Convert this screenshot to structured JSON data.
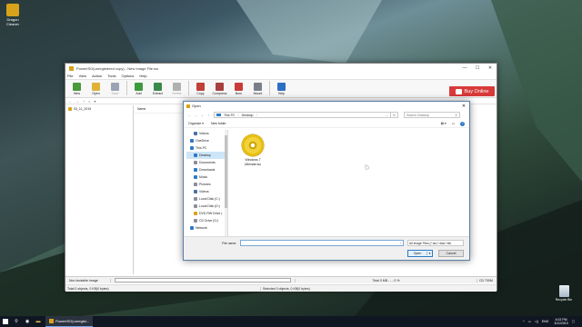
{
  "desktop": {
    "icon_label": "Dragon Cleaner",
    "recycle_label": "Recycle Bin"
  },
  "app": {
    "title": "PowerISO(unregistered copy) - New Image File.iso",
    "window_buttons": {
      "minimize": "—",
      "maximize": "☐",
      "close": "✕"
    },
    "menu": [
      "File",
      "View",
      "Action",
      "Tools",
      "Options",
      "Help"
    ],
    "toolbar": [
      {
        "label": "New",
        "icon": "new-icon",
        "color": "#4a9a3c",
        "disabled": false
      },
      {
        "label": "Open",
        "icon": "open-icon",
        "color": "#e0b23a",
        "disabled": false
      },
      {
        "label": "Save",
        "icon": "save-icon",
        "color": "#9aa4b2",
        "disabled": true
      },
      {
        "label": "Add",
        "icon": "add-icon",
        "color": "#3e9a3e",
        "disabled": false
      },
      {
        "label": "Extract",
        "icon": "extract-icon",
        "color": "#3a8a4a",
        "disabled": false
      },
      {
        "label": "Delete",
        "icon": "delete-icon",
        "color": "#b0b0b0",
        "disabled": true
      },
      {
        "label": "Copy",
        "icon": "copy-icon",
        "color": "#c0403a",
        "disabled": false
      },
      {
        "label": "Compress",
        "icon": "compress-icon",
        "color": "#a84040",
        "disabled": false
      },
      {
        "label": "Burn",
        "icon": "burn-icon",
        "color": "#c93a3a",
        "disabled": false
      },
      {
        "label": "Mount",
        "icon": "mount-icon",
        "color": "#7a7f88",
        "disabled": false
      },
      {
        "label": "Help",
        "icon": "help-icon",
        "color": "#2d6fc4",
        "disabled": false
      }
    ],
    "buy_label": "Buy Online",
    "nav_glyphs": [
      "←",
      "→",
      "↑",
      "⌂",
      "▾"
    ],
    "tree_root": "03_11_2019",
    "column_name": "Name",
    "status_type": "Non-bootable Image",
    "status_total": "Total 0 MB  - - -  0 %",
    "status_media": "CD 700M",
    "status_objects_left": "Total 0 objects, 0 KB(0 bytes)",
    "status_objects_right": "Selected 0 objects, 0 KB(0 bytes)"
  },
  "dialog": {
    "title": "Open",
    "close": "✕",
    "address": {
      "root": "This PC",
      "current": "Desktop"
    },
    "search_placeholder": "Search Desktop",
    "organize": "Organize ▾",
    "new_folder": "New folder",
    "nav_items": [
      {
        "label": "Videos",
        "icon": "videos-icon",
        "color": "#4a6fa5",
        "top": false,
        "selected": false
      },
      {
        "label": "OneDrive",
        "icon": "onedrive-icon",
        "color": "#2d7ac6",
        "top": true,
        "selected": false
      },
      {
        "label": "This PC",
        "icon": "this-pc-icon",
        "color": "#2d7ac6",
        "top": true,
        "selected": false
      },
      {
        "label": "Desktop",
        "icon": "desktop-icon",
        "color": "#2d7ac6",
        "top": false,
        "selected": true
      },
      {
        "label": "Documents",
        "icon": "documents-icon",
        "color": "#8a8f98",
        "top": false,
        "selected": false
      },
      {
        "label": "Downloads",
        "icon": "downloads-icon",
        "color": "#2d7ac6",
        "top": false,
        "selected": false
      },
      {
        "label": "Music",
        "icon": "music-icon",
        "color": "#2d7ac6",
        "top": false,
        "selected": false
      },
      {
        "label": "Pictures",
        "icon": "pictures-icon",
        "color": "#8a8f98",
        "top": false,
        "selected": false
      },
      {
        "label": "Videos",
        "icon": "videos-icon",
        "color": "#4a6fa5",
        "top": false,
        "selected": false
      },
      {
        "label": "Local Disk (C:)",
        "icon": "disk-icon",
        "color": "#8a8f98",
        "top": false,
        "selected": false
      },
      {
        "label": "Local Disk (D:)",
        "icon": "disk-icon",
        "color": "#8a8f98",
        "top": false,
        "selected": false
      },
      {
        "label": "DVD RW Drive (",
        "icon": "dvd-drive-icon",
        "color": "#d8a21a",
        "top": false,
        "selected": false
      },
      {
        "label": "CD Drive (G:)",
        "icon": "cd-drive-icon",
        "color": "#8a8f98",
        "top": false,
        "selected": false
      },
      {
        "label": "Network",
        "icon": "network-icon",
        "color": "#2d7ac6",
        "top": true,
        "selected": false
      }
    ],
    "file": {
      "name_line1": "Windows 7",
      "name_line2": "Ultimate.iso"
    },
    "file_name_label": "File name:",
    "file_name_value": "",
    "file_type": "All Image Files (*.iso;*.daa;*.bin",
    "open_label": "Open",
    "cancel_label": "Cancel"
  },
  "taskbar": {
    "app_label": "PowerISO(unregist...",
    "tray_lang": "ENG",
    "time": "4:02 PM",
    "date": "3/11/2019"
  }
}
